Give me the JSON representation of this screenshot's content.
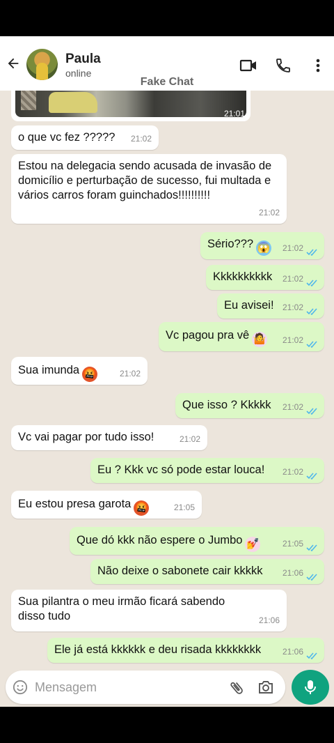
{
  "header": {
    "contact_name": "Paula",
    "contact_status": "online",
    "watermark": "Fake Chat"
  },
  "image_message": {
    "time": "21:01"
  },
  "messages": [
    {
      "dir": "in",
      "text": "o que vc fez ?????",
      "time": "21:02"
    },
    {
      "dir": "in",
      "text": "Estou na delegacia sendo acusada de invasão de domicílio e perturbação de sucesso, fui multada e vários carros foram guinchados!!!!!!!!!!",
      "time": "21:02"
    },
    {
      "dir": "out",
      "text": "Sério???",
      "emoji": "scream-emoji",
      "time": "21:02"
    },
    {
      "dir": "out",
      "text": "Kkkkkkkkkk",
      "time": "21:02"
    },
    {
      "dir": "out",
      "text": "Eu avisei!",
      "time": "21:02"
    },
    {
      "dir": "out",
      "text": "Vc pagou pra vê",
      "emoji": "shrug-emoji",
      "time": "21:02"
    },
    {
      "dir": "in",
      "text": "Sua imunda",
      "emoji": "cursing-face-emoji",
      "time": "21:02"
    },
    {
      "dir": "out",
      "text": "Que isso ? Kkkkk",
      "time": "21:02"
    },
    {
      "dir": "in",
      "text": "Vc vai pagar por tudo isso!",
      "time": "21:02"
    },
    {
      "dir": "out",
      "text": "Eu ? Kkk vc só pode estar louca!",
      "time": "21:02"
    },
    {
      "dir": "in",
      "text": "Eu estou presa garota",
      "emoji": "cursing-face-emoji",
      "time": "21:05"
    },
    {
      "dir": "out",
      "text": "Que dó kkk não espere o Jumbo",
      "emoji": "nail-polish-emoji",
      "time": "21:05"
    },
    {
      "dir": "out",
      "text": "Não deixe o sabonete cair kkkkk",
      "time": "21:06"
    },
    {
      "dir": "in",
      "text": "Sua pilantra o meu irmão ficará sabendo disso tudo",
      "time": "21:06"
    },
    {
      "dir": "out",
      "text": "Ele já está kkkkkk e deu risada kkkkkkkk",
      "time": "21:06"
    }
  ],
  "input": {
    "placeholder": "Mensagem"
  },
  "colors": {
    "incoming_bubble": "#ffffff",
    "outgoing_bubble": "#dcf8c6",
    "chat_background": "#ece5dc",
    "mic_button": "#10a37f",
    "read_ticks": "#4fb6ec"
  }
}
